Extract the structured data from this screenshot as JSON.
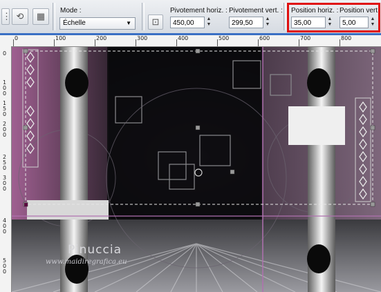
{
  "toolbar": {
    "mode_label": "Mode :",
    "mode_value": "Échelle",
    "pivot_h_label": "Pivotement horiz. :",
    "pivot_h_value": "450,00",
    "pivot_v_label": "Pivotement vert. :",
    "pivot_v_value": "299,50",
    "pos_h_label": "Position horiz. :",
    "pos_h_value": "35,00",
    "pos_v_label": "Position vert.",
    "pos_v_value": "5,00"
  },
  "ruler_top": {
    "labels": [
      "0",
      "100",
      "200",
      "300",
      "400",
      "500",
      "600",
      "700",
      "800"
    ]
  },
  "ruler_left": {
    "labels": [
      "0",
      "1",
      "0",
      "0",
      "1",
      "5",
      "0",
      "2",
      "0",
      "0",
      "2",
      "5",
      "0",
      "3",
      "0",
      "0",
      "4",
      "0",
      "0",
      "5",
      "0",
      "0"
    ]
  },
  "watermark": {
    "name": "Pinuccia",
    "url": "www.maidiregrafica.eu"
  },
  "colors": {
    "highlight": "#e01010",
    "accent_blue": "#3a6fc4",
    "pink_glow": "#b06aa0"
  }
}
